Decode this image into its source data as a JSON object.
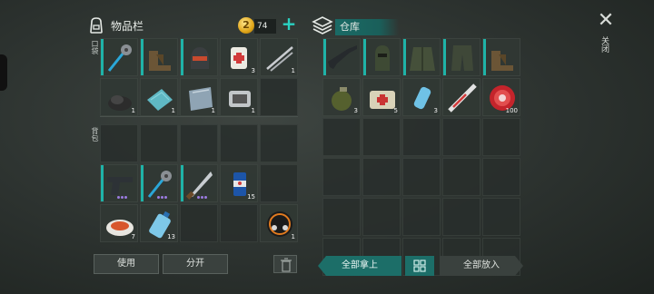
{
  "inventory": {
    "title": "物品栏",
    "coins": "74",
    "add_label": "+",
    "pocket_label": "口袋",
    "backpack_label": "背包",
    "pocket_slots": [
      {
        "item": "hammer-icon",
        "qty": "",
        "equipped": true,
        "rarity": 0
      },
      {
        "item": "boots-icon",
        "qty": "",
        "equipped": true,
        "rarity": 0
      },
      {
        "item": "helmet-icon",
        "qty": "",
        "equipped": true,
        "rarity": 0
      },
      {
        "item": "bandage-icon",
        "qty": "3",
        "equipped": false,
        "rarity": 0
      },
      {
        "item": "nails-icon",
        "qty": "1",
        "equipped": false,
        "rarity": 0
      },
      {
        "item": "coal-icon",
        "qty": "1",
        "equipped": false,
        "rarity": 0
      },
      {
        "item": "cloth-icon",
        "qty": "1",
        "equipped": false,
        "rarity": 0
      },
      {
        "item": "plate-icon",
        "qty": "1",
        "equipped": false,
        "rarity": 0
      },
      {
        "item": "engine-part-icon",
        "qty": "1",
        "equipped": false,
        "rarity": 0
      },
      {
        "item": "",
        "qty": "",
        "equipped": false,
        "rarity": 0
      }
    ],
    "backpack_slots": [
      {
        "item": "",
        "qty": "",
        "equipped": false,
        "rarity": 0
      },
      {
        "item": "",
        "qty": "",
        "equipped": false,
        "rarity": 0
      },
      {
        "item": "",
        "qty": "",
        "equipped": false,
        "rarity": 0
      },
      {
        "item": "",
        "qty": "",
        "equipped": false,
        "rarity": 0
      },
      {
        "item": "",
        "qty": "",
        "equipped": false,
        "rarity": 0
      },
      {
        "item": "pistol-icon",
        "qty": "",
        "equipped": true,
        "rarity": 3
      },
      {
        "item": "hammer-icon",
        "qty": "",
        "equipped": true,
        "rarity": 3
      },
      {
        "item": "machete-icon",
        "qty": "",
        "equipped": true,
        "rarity": 3
      },
      {
        "item": "can-icon",
        "qty": "15",
        "equipped": false,
        "rarity": 0
      },
      {
        "item": "",
        "qty": "",
        "equipped": false,
        "rarity": 0
      },
      {
        "item": "food-plate-icon",
        "qty": "7",
        "equipped": false,
        "rarity": 0
      },
      {
        "item": "water-bottle-icon",
        "qty": "13",
        "equipped": false,
        "rarity": 0
      },
      {
        "item": "",
        "qty": "",
        "equipped": false,
        "rarity": 0
      },
      {
        "item": "",
        "qty": "",
        "equipped": false,
        "rarity": 0
      },
      {
        "item": "motorcycle-badge-icon",
        "qty": "1",
        "equipped": false,
        "rarity": 0
      }
    ],
    "use_button": "使用",
    "split_button": "分开"
  },
  "stash": {
    "title": "仓库",
    "slots": [
      {
        "item": "rifle-icon",
        "qty": "",
        "equipped": true,
        "rarity": 0
      },
      {
        "item": "balaclava-icon",
        "qty": "",
        "equipped": true,
        "rarity": 0
      },
      {
        "item": "jacket-icon",
        "qty": "",
        "equipped": true,
        "rarity": 0
      },
      {
        "item": "pants-icon",
        "qty": "",
        "equipped": true,
        "rarity": 0
      },
      {
        "item": "boots-icon",
        "qty": "",
        "equipped": true,
        "rarity": 0
      },
      {
        "item": "grenade-icon",
        "qty": "3",
        "equipped": false,
        "rarity": 0
      },
      {
        "item": "medkit-icon",
        "qty": "5",
        "equipped": false,
        "rarity": 0
      },
      {
        "item": "inhaler-icon",
        "qty": "3",
        "equipped": false,
        "rarity": 0
      },
      {
        "item": "syringe-icon",
        "qty": "",
        "equipped": false,
        "rarity": 0
      },
      {
        "item": "bottle-cap-icon",
        "qty": "100",
        "equipped": false,
        "rarity": 0
      }
    ],
    "empty_rows": 4,
    "take_all_button": "全部拿上",
    "put_all_button": "全部放入"
  },
  "close_label": "关闭",
  "colors": {
    "accent": "#1fb3a8",
    "button_teal": "#1c6e68",
    "rarity": "#9b7be0"
  }
}
